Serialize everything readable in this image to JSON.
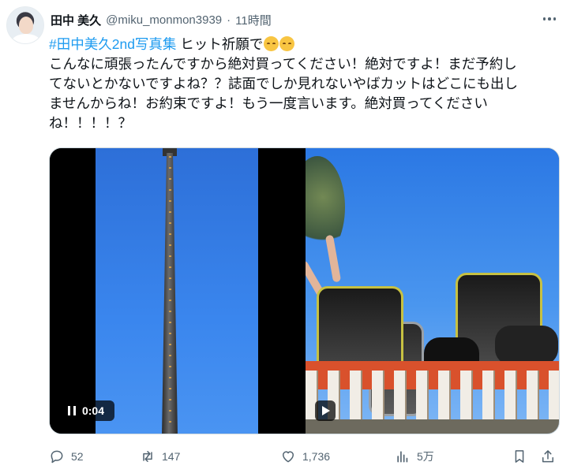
{
  "tweet": {
    "author_name": "田中 美久",
    "author_handle": "@miku_monmon3939",
    "separator": "·",
    "time": "11時間",
    "text": {
      "hashtag": "#田中美久2nd写真集",
      "line1_rest": " ヒット祈願で",
      "line2": "こんなに頑張ったんですから絶対買ってください！絶対ですよ！まだ予約し",
      "line3": "てないとかないですよね？？誌面でしか見れないやばカットはどこにも出し",
      "line4": "ませんからね！お約束ですよ！もう一度言います。絶対買ってくださいね",
      "line4_display": "ませんからね！お約束ですよ！もう一度言います。絶対買ってくださ",
      "line5": "い",
      "line6": "ね！！！！？"
    },
    "emojis": [
      "pensive-face-emoji",
      "pensive-face-emoji"
    ],
    "media": {
      "video1_time": "0:04",
      "video1_state": "pause-icon",
      "video2_state": "play-icon"
    },
    "actions": {
      "replies": "52",
      "retweets": "147",
      "likes": "1,736",
      "views": "5万"
    }
  },
  "colors": {
    "accent": "#1d9bf0",
    "muted": "#536471",
    "text": "#0f1419"
  }
}
